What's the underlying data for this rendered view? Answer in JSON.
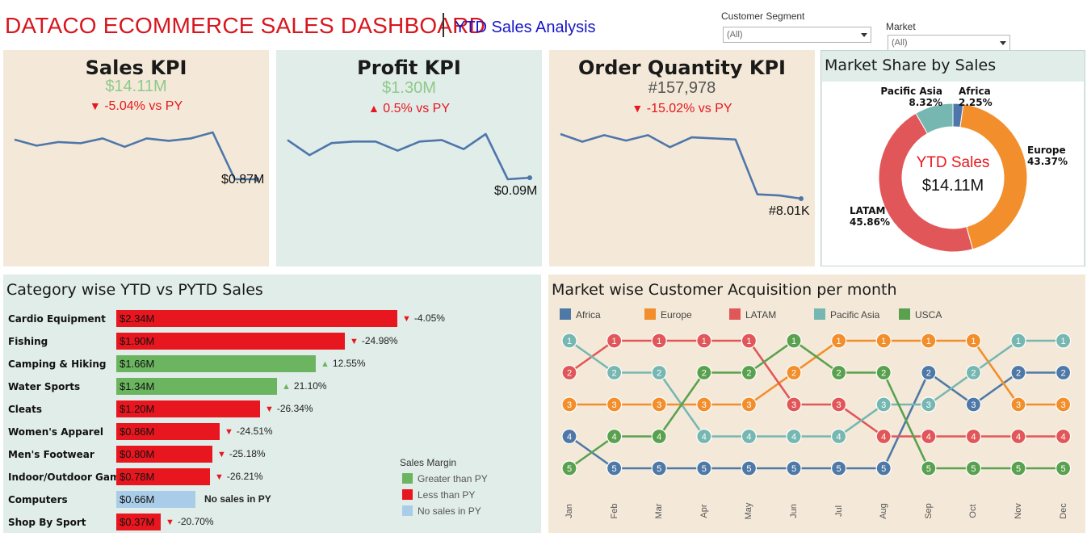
{
  "header": {
    "title": "DATACO ECOMMERCE SALES DASHBOARD",
    "subtitle": "YTD Sales Analysis"
  },
  "filters": {
    "customer_segment": {
      "label": "Customer Segment",
      "value": "(All)"
    },
    "market": {
      "label": "Market",
      "value": "(All)"
    }
  },
  "colors": {
    "beige": "#f4e9d8",
    "teal": "#e1ede9",
    "line": "#4f76aa",
    "red": "#e8161e",
    "green": "#6cb560",
    "lightblue": "#a9cde9"
  },
  "kpis": {
    "sales": {
      "title": "Sales KPI",
      "value": "$14.11M",
      "delta": "-5.04% vs PY",
      "direction": "down",
      "end_label": "$0.87M",
      "value_color": "#8ec98a"
    },
    "profit": {
      "title": "Profit KPI",
      "value": "$1.30M",
      "delta": "0.5% vs PY",
      "direction": "up",
      "end_label": "$0.09M",
      "value_color": "#8ec98a"
    },
    "orders": {
      "title": "Order Quantity KPI",
      "value": "#157,978",
      "delta": "-15.02% vs PY",
      "direction": "down",
      "end_label": "#8.01K",
      "value_color": "#555555"
    }
  },
  "market_share": {
    "title": "Market Share by Sales",
    "center_title": "YTD Sales",
    "center_value": "$14.11M",
    "segments": [
      {
        "name": "Africa",
        "pct": 2.25,
        "label": "2.25%",
        "color": "#4f76aa"
      },
      {
        "name": "Europe",
        "pct": 43.37,
        "label": "43.37%",
        "color": "#f28e2b"
      },
      {
        "name": "LATAM",
        "pct": 45.86,
        "label": "45.86%",
        "color": "#e15759"
      },
      {
        "name": "Pacific Asia",
        "pct": 8.32,
        "label": "8.32%",
        "color": "#76b7b2"
      }
    ]
  },
  "category": {
    "title": "Category wise YTD vs PYTD Sales",
    "rows": [
      {
        "name": "Cardio Equipment",
        "value": 2.34,
        "label": "$2.34M",
        "delta": "-4.05%",
        "status": "less"
      },
      {
        "name": "Fishing",
        "value": 1.9,
        "label": "$1.90M",
        "delta": "-24.98%",
        "status": "less"
      },
      {
        "name": "Camping & Hiking",
        "value": 1.66,
        "label": "$1.66M",
        "delta": "12.55%",
        "status": "greater"
      },
      {
        "name": "Water Sports",
        "value": 1.34,
        "label": "$1.34M",
        "delta": "21.10%",
        "status": "greater"
      },
      {
        "name": "Cleats",
        "value": 1.2,
        "label": "$1.20M",
        "delta": "-26.34%",
        "status": "less"
      },
      {
        "name": "Women's Apparel",
        "value": 0.86,
        "label": "$0.86M",
        "delta": "-24.51%",
        "status": "less"
      },
      {
        "name": "Men's Footwear",
        "value": 0.8,
        "label": "$0.80M",
        "delta": "-25.18%",
        "status": "less"
      },
      {
        "name": "Indoor/Outdoor Games",
        "value": 0.78,
        "label": "$0.78M",
        "delta": "-26.21%",
        "status": "less"
      },
      {
        "name": "Computers",
        "value": 0.66,
        "label": "$0.66M",
        "delta": "No sales in PY",
        "status": "none"
      },
      {
        "name": "Shop By Sport",
        "value": 0.37,
        "label": "$0.37M",
        "delta": "-20.70%",
        "status": "less"
      }
    ],
    "legend": {
      "title": "Sales Margin",
      "greater": "Greater than PY",
      "less": "Less than PY",
      "none": "No sales in PY"
    }
  },
  "acquisition": {
    "title": "Market wise Customer Acquisition per month",
    "months": [
      "Jan",
      "Feb",
      "Mar",
      "Apr",
      "May",
      "Jun",
      "Jul",
      "Aug",
      "Sep",
      "Oct",
      "Nov",
      "Dec"
    ],
    "series": [
      {
        "name": "Africa",
        "color": "#4e79a7",
        "ranks": [
          4,
          5,
          5,
          5,
          5,
          5,
          5,
          5,
          2,
          3,
          2,
          2
        ]
      },
      {
        "name": "Europe",
        "color": "#f28e2b",
        "ranks": [
          3,
          3,
          3,
          3,
          3,
          2,
          1,
          1,
          1,
          1,
          3,
          3
        ]
      },
      {
        "name": "LATAM",
        "color": "#e15759",
        "ranks": [
          2,
          1,
          1,
          1,
          1,
          3,
          3,
          4,
          4,
          4,
          4,
          4
        ]
      },
      {
        "name": "Pacific Asia",
        "color": "#76b7b2",
        "ranks": [
          1,
          2,
          2,
          4,
          4,
          4,
          4,
          3,
          3,
          2,
          1,
          1
        ]
      },
      {
        "name": "USCA",
        "color": "#59a14f",
        "ranks": [
          5,
          4,
          4,
          2,
          2,
          1,
          2,
          2,
          5,
          5,
          5,
          5
        ]
      }
    ]
  },
  "chart_data": [
    {
      "type": "line",
      "title": "Sales KPI",
      "x": [
        "Jan",
        "Feb",
        "Mar",
        "Apr",
        "May",
        "Jun",
        "Jul",
        "Aug",
        "Sep",
        "Oct",
        "Nov",
        "Dec"
      ],
      "values": [
        1.2,
        1.15,
        1.18,
        1.17,
        1.21,
        1.14,
        1.21,
        1.19,
        1.21,
        1.26,
        0.87,
        0.87
      ],
      "end_label": "$0.87M"
    },
    {
      "type": "line",
      "title": "Profit KPI",
      "x": [
        "Jan",
        "Feb",
        "Mar",
        "Apr",
        "May",
        "Jun",
        "Jul",
        "Aug",
        "Sep",
        "Oct",
        "Nov",
        "Dec"
      ],
      "values": [
        0.115,
        0.105,
        0.113,
        0.114,
        0.114,
        0.108,
        0.114,
        0.115,
        0.109,
        0.119,
        0.089,
        0.09
      ],
      "end_label": "$0.09M"
    },
    {
      "type": "line",
      "title": "Order Quantity KPI",
      "x": [
        "Jan",
        "Feb",
        "Mar",
        "Apr",
        "May",
        "Jun",
        "Jul",
        "Aug",
        "Sep",
        "Oct",
        "Nov",
        "Dec"
      ],
      "values": [
        13.9,
        13.2,
        13.8,
        13.3,
        13.8,
        12.7,
        13.6,
        13.5,
        13.4,
        8.4,
        8.3,
        8.01
      ],
      "end_label": "#8.01K"
    },
    {
      "type": "pie",
      "title": "Market Share by Sales",
      "categories": [
        "Africa",
        "Europe",
        "LATAM",
        "Pacific Asia"
      ],
      "values": [
        2.25,
        43.37,
        45.86,
        8.32
      ]
    },
    {
      "type": "bar",
      "title": "Category wise YTD vs PYTD Sales",
      "categories": [
        "Cardio Equipment",
        "Fishing",
        "Camping & Hiking",
        "Water Sports",
        "Cleats",
        "Women's Apparel",
        "Men's Footwear",
        "Indoor/Outdoor Games",
        "Computers",
        "Shop By Sport"
      ],
      "values": [
        2.34,
        1.9,
        1.66,
        1.34,
        1.2,
        0.86,
        0.8,
        0.78,
        0.66,
        0.37
      ]
    },
    {
      "type": "line",
      "title": "Market wise Customer Acquisition per month",
      "x": [
        "Jan",
        "Feb",
        "Mar",
        "Apr",
        "May",
        "Jun",
        "Jul",
        "Aug",
        "Sep",
        "Oct",
        "Nov",
        "Dec"
      ],
      "series": [
        {
          "name": "Africa",
          "values": [
            4,
            5,
            5,
            5,
            5,
            5,
            5,
            5,
            2,
            3,
            2,
            2
          ]
        },
        {
          "name": "Europe",
          "values": [
            3,
            3,
            3,
            3,
            3,
            2,
            1,
            1,
            1,
            1,
            3,
            3
          ]
        },
        {
          "name": "LATAM",
          "values": [
            2,
            1,
            1,
            1,
            1,
            3,
            3,
            4,
            4,
            4,
            4,
            4
          ]
        },
        {
          "name": "Pacific Asia",
          "values": [
            1,
            2,
            2,
            4,
            4,
            4,
            4,
            3,
            3,
            2,
            1,
            1
          ]
        },
        {
          "name": "USCA",
          "values": [
            5,
            4,
            4,
            2,
            2,
            1,
            2,
            2,
            5,
            5,
            5,
            5
          ]
        }
      ]
    }
  ]
}
